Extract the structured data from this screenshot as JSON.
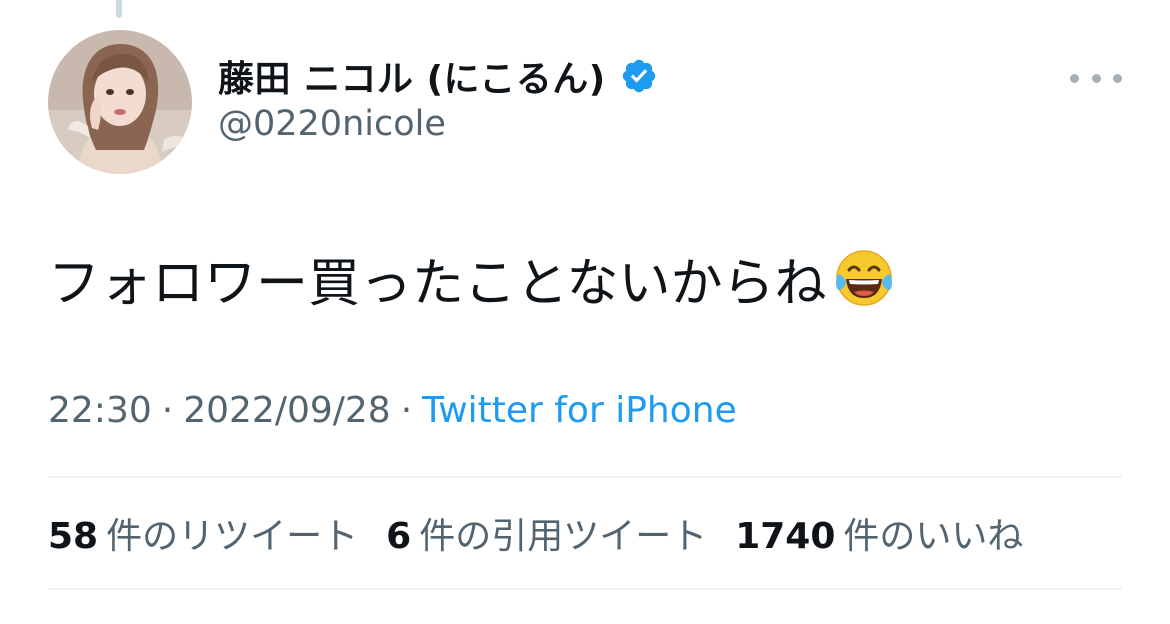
{
  "author": {
    "display_name": "藤田 ニコル (にこるん)",
    "handle": "@0220nicole",
    "verified_icon": "verified-badge-icon"
  },
  "tweet": {
    "text": "フォロワー買ったことないからね",
    "emoji": "face-with-tears-of-joy-emoji"
  },
  "meta": {
    "time": "22:30",
    "separator1": "·",
    "date": "2022/09/28",
    "separator2": "·",
    "source": "Twitter for iPhone"
  },
  "stats": {
    "retweets": {
      "count": "58",
      "label": "件のリツイート"
    },
    "quotes": {
      "count": "6",
      "label": "件の引用ツイート"
    },
    "likes": {
      "count": "1740",
      "label": "件のいいね"
    }
  },
  "colors": {
    "text": "#0f1419",
    "secondary": "#536471",
    "link": "#1d9bf0",
    "divider": "#eff3f4"
  }
}
